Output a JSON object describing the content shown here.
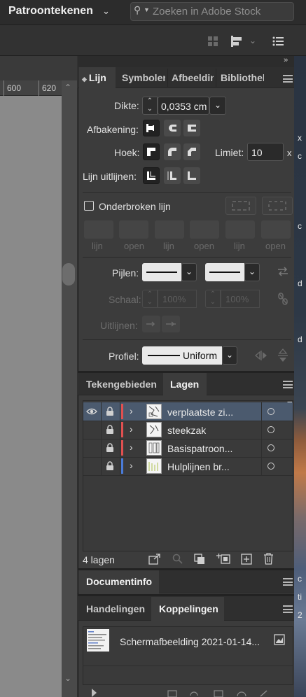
{
  "workspace": {
    "title": "Patroontekenen"
  },
  "search": {
    "placeholder": "Zoeken in Adobe Stock"
  },
  "ruler": {
    "ticks": [
      "600",
      "620"
    ]
  },
  "desktop_edge_text": [
    "x",
    "c",
    "c",
    "d",
    "d",
    "c",
    "ti",
    "2"
  ],
  "stroke_panel": {
    "tabs": [
      "Lijn",
      "Symbolen",
      "Afbeeldingen",
      "Bibliotheken"
    ],
    "active_tab": "Lijn",
    "weight_label": "Dikte:",
    "weight_value": "0,0353 cm",
    "cap_label": "Afbakening:",
    "corner_label": "Hoek:",
    "limit_label": "Limiet:",
    "limit_value": "10",
    "limit_suffix": "x",
    "align_label": "Lijn uitlijnen:",
    "dashed_label": "Onderbroken lijn",
    "dashed_checked": false,
    "dash_labels": [
      "lijn",
      "open",
      "lijn",
      "open",
      "lijn",
      "open"
    ],
    "arrows_label": "Pijlen:",
    "scale_label": "Schaal:",
    "scale_values": [
      "100%",
      "100%"
    ],
    "arrow_align_label": "Uitlijnen:",
    "profile_label": "Profiel:",
    "profile_value": "Uniform"
  },
  "layers_panel": {
    "tabs": [
      "Tekengebieden",
      "Lagen"
    ],
    "active_tab": "Lagen",
    "layers": [
      {
        "name": "verplaatste zi...",
        "visible": true,
        "locked": true,
        "color": "#e05050",
        "selected": true
      },
      {
        "name": "steekzak",
        "visible": false,
        "locked": true,
        "color": "#e05050",
        "selected": false
      },
      {
        "name": "Basispatroon...",
        "visible": false,
        "locked": true,
        "color": "#e05050",
        "selected": false
      },
      {
        "name": "Hulplijnen br...",
        "visible": false,
        "locked": true,
        "color": "#4a7bd8",
        "selected": false
      }
    ],
    "count_label": "4 lagen"
  },
  "docinfo_panel": {
    "tab": "Documentinfo"
  },
  "links_panel": {
    "tabs": [
      "Handelingen",
      "Koppelingen"
    ],
    "active_tab": "Koppelingen",
    "link_name": "Schermafbeelding 2021-01-14..."
  }
}
